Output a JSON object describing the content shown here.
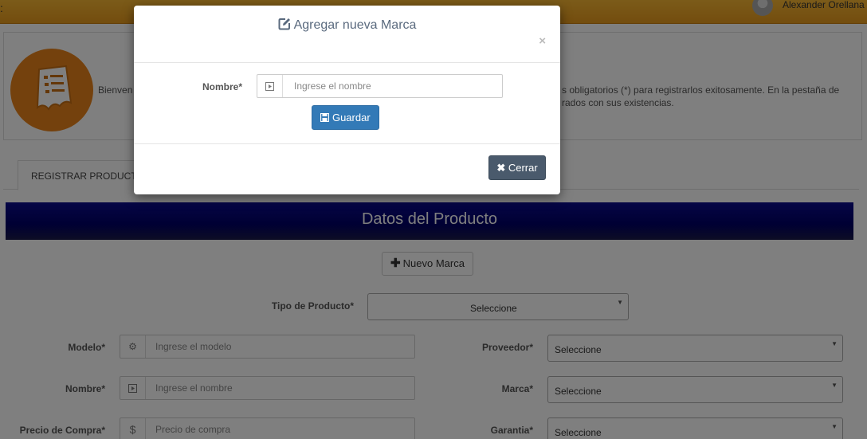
{
  "topbar": {
    "user_name": "Alexander Orellana"
  },
  "welcome": {
    "text_left": "Bienven",
    "text_right_1": "s obligatorios (*) para registrarlos exitosamente. En la pestaña de",
    "text_right_2": "rados con sus existencias."
  },
  "tabs": [
    {
      "label": "REGISTRAR PRODUCTO"
    }
  ],
  "section": {
    "title": "Datos del Producto"
  },
  "new_brand_button": {
    "label": "Nuevo Marca"
  },
  "form": {
    "tipo_producto": {
      "label": "Tipo de Producto*",
      "value": "Seleccione"
    },
    "modelo": {
      "label": "Modelo*",
      "placeholder": "Ingrese el modelo",
      "icon": "gear-icon"
    },
    "nombre": {
      "label": "Nombre*",
      "placeholder": "Ingrese el nombre",
      "icon": "play-square-icon"
    },
    "precio_compra": {
      "label": "Precio de Compra*",
      "placeholder": "Precio de compra",
      "icon": "dollar-icon"
    },
    "proveedor": {
      "label": "Proveedor*",
      "value": "Seleccione"
    },
    "marca": {
      "label": "Marca*",
      "value": "Seleccione"
    },
    "garantia": {
      "label": "Garantia*",
      "value": "Seleccione"
    }
  },
  "modal": {
    "title": "Agregar nueva Marca",
    "close_symbol": "×",
    "field_label": "Nombre*",
    "field_placeholder": "Ingrese el nombre",
    "save_label": "Guardar",
    "close_label": "Cerrar"
  },
  "colors": {
    "primary": "#337ab7",
    "header_bg": "#000066",
    "logo": "#e8831a",
    "topbar": "#f0a62a"
  }
}
